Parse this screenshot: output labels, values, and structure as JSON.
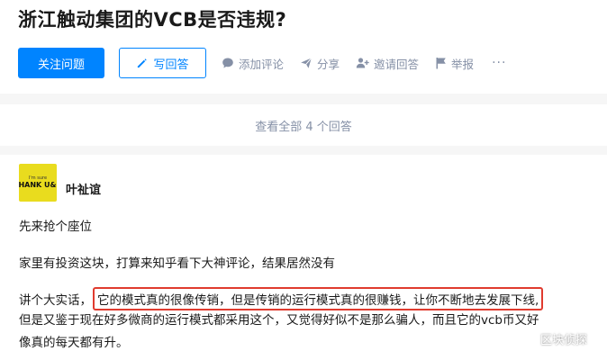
{
  "question": {
    "title": "浙江触动集团的VCB是否违规?"
  },
  "actions": {
    "follow_label": "关注问题",
    "write_answer_label": "写回答",
    "comment_label": "添加评论",
    "share_label": "分享",
    "invite_label": "邀请回答",
    "report_label": "举报",
    "more_label": "···"
  },
  "answers_summary": {
    "view_all_label": "查看全部 4 个回答"
  },
  "answer": {
    "author": "叶祉谊",
    "avatar_text_small": "I'm sure",
    "avatar_text_big": "THANK U&U",
    "paragraph1": "先来抢个座位",
    "paragraph2": "家里有投资这块，打算来知乎看下大神评论，结果居然没有",
    "paragraph3_prefix": "讲个大实话，",
    "paragraph3_highlight": "它的模式真的很像传销，但是传销的运行模式真的很赚钱，让你不断地去发展下线,",
    "paragraph3_line2": "但是又鉴于现在好多微商的运行模式都采用这个，又觉得好似不是那么骗人，而且它的vcb币又好",
    "paragraph3_line3": "像真的每天都有升。"
  },
  "watermark": {
    "text": "区块侦探"
  },
  "colors": {
    "accent": "#0084ff",
    "highlight_border": "#e03b2f",
    "muted": "#8590a6",
    "avatar_bg": "#e9dc1e"
  },
  "icons": {
    "write": "pencil-icon",
    "comment": "comment-bubble-icon",
    "share": "paper-plane-icon",
    "invite": "add-person-icon",
    "report": "flag-icon",
    "watermark": "wechat-icon"
  }
}
